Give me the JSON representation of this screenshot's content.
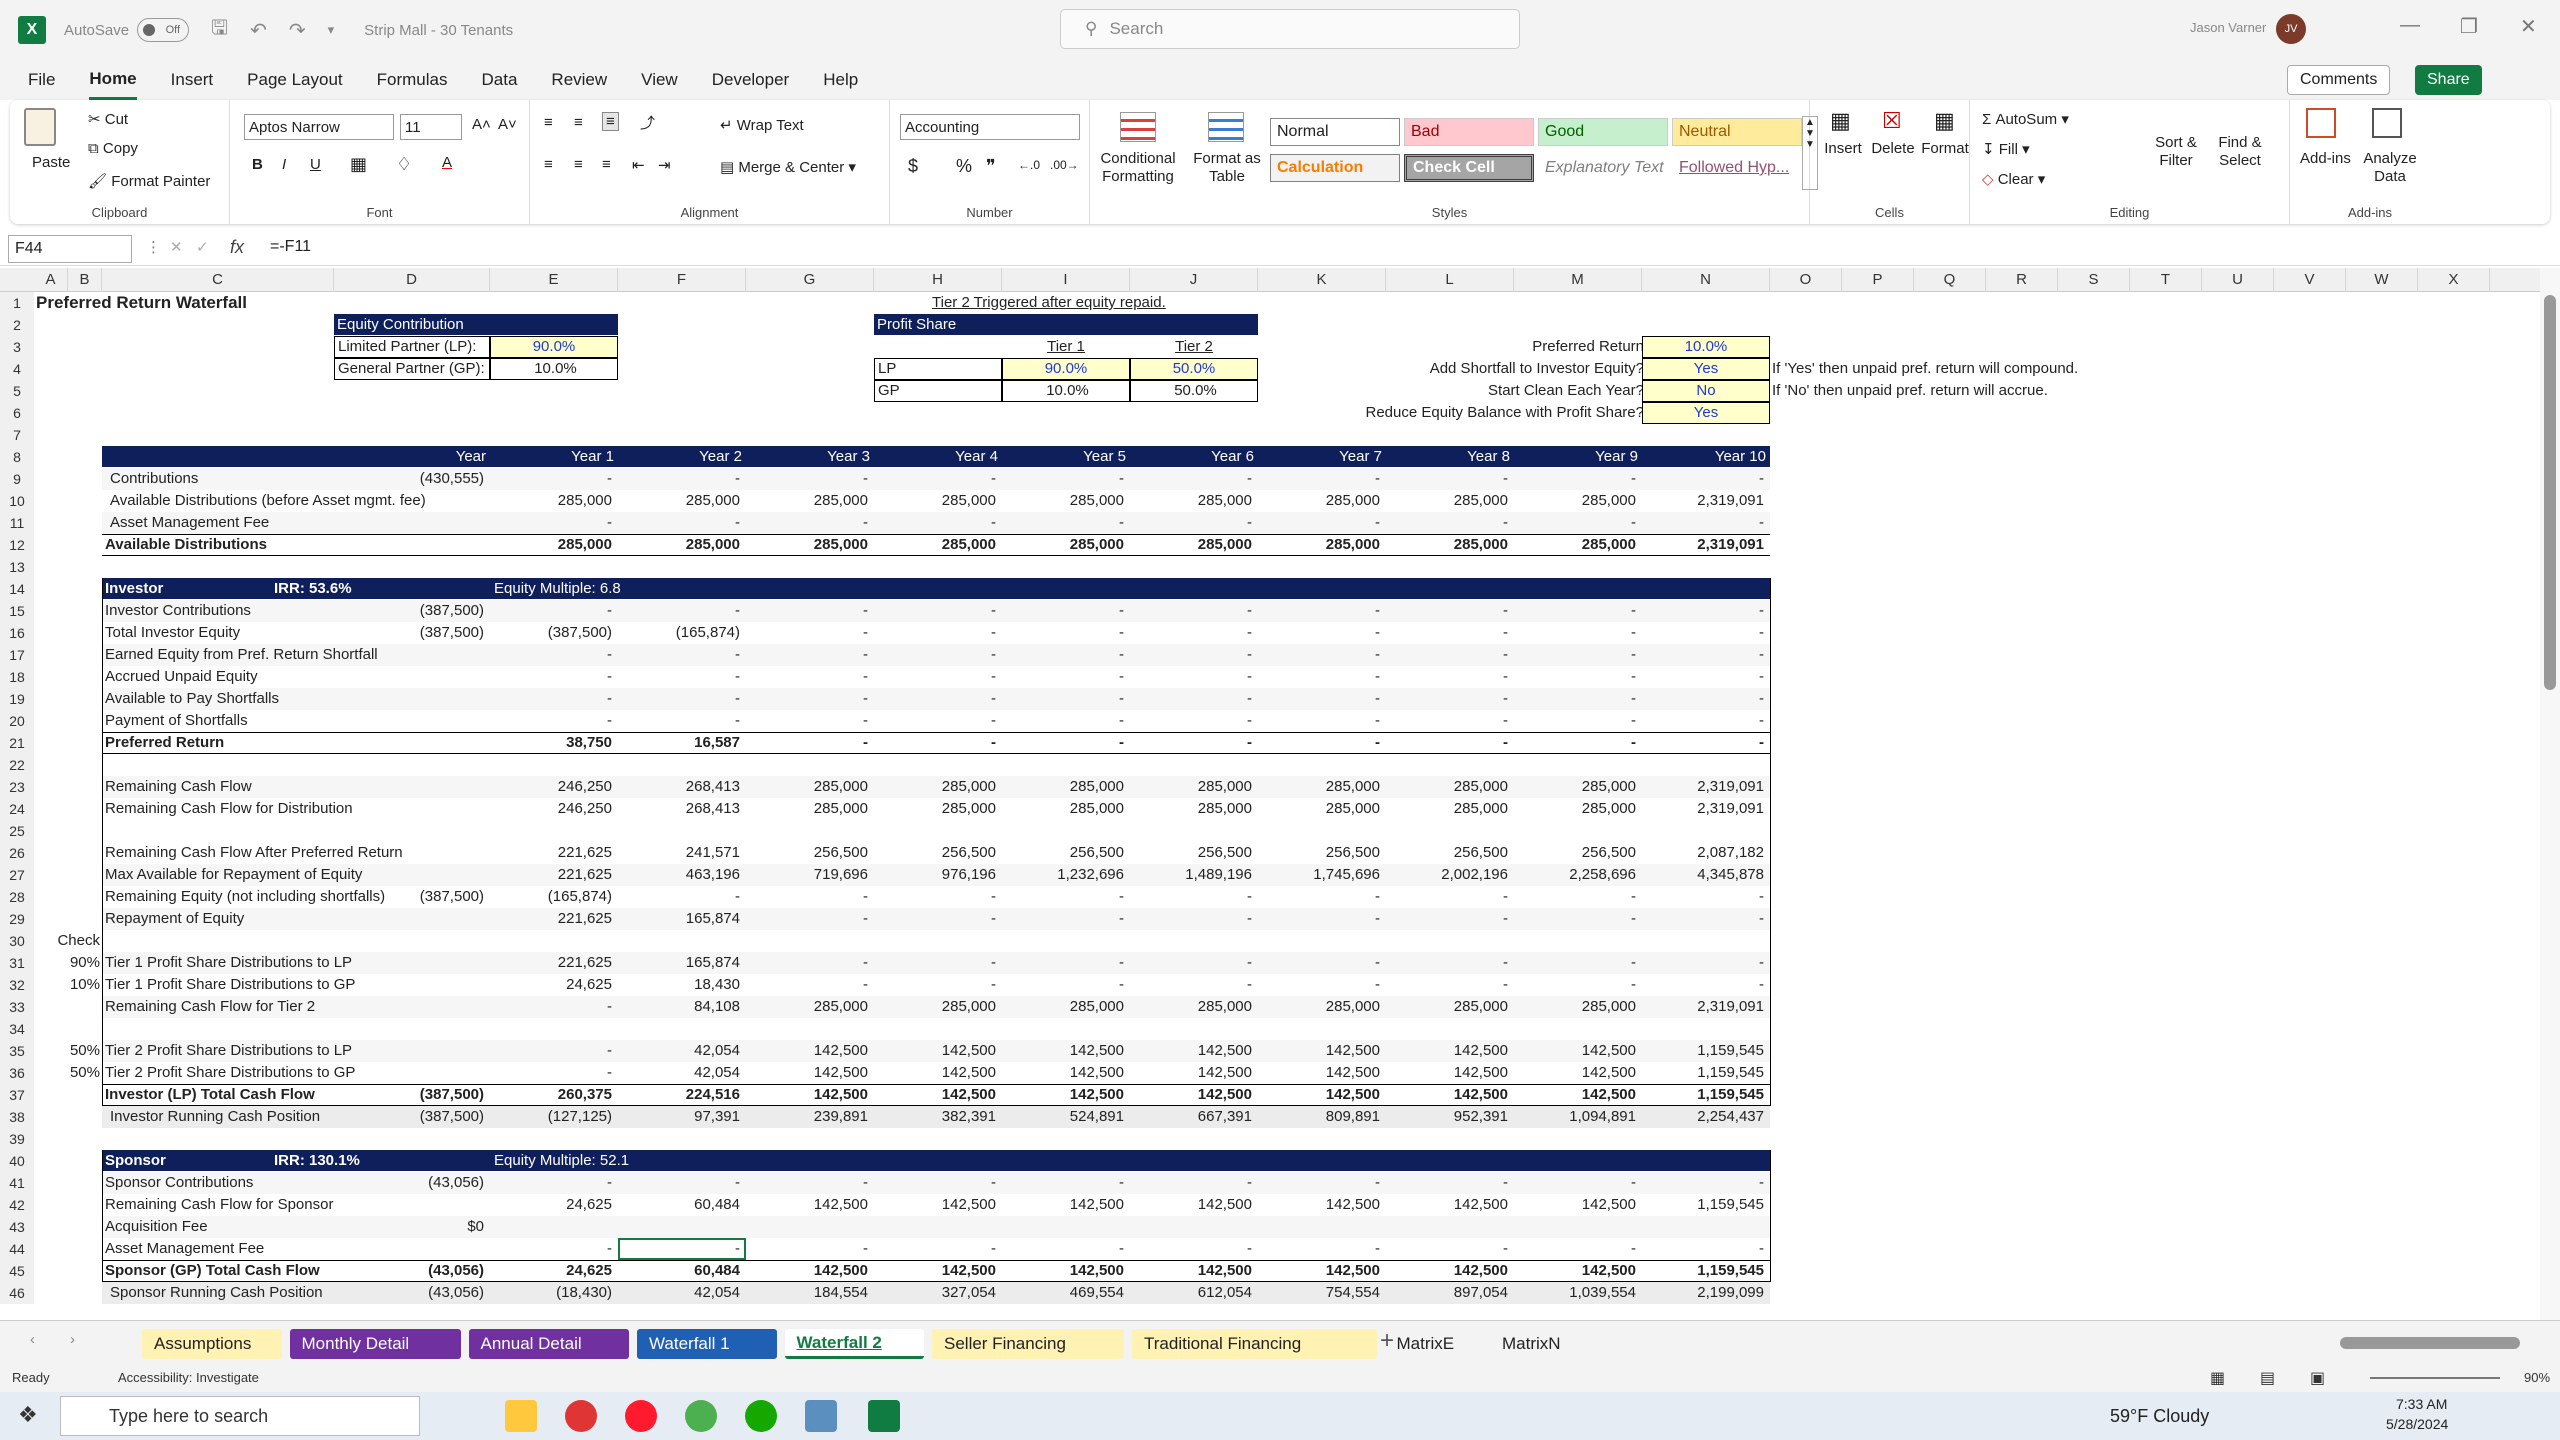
{
  "titlebar": {
    "autosave": "AutoSave",
    "autosave_state": "Off",
    "doc_title": "Strip Mall - 30 Tenants",
    "search_placeholder": "Search",
    "user": "Jason Varner",
    "initials": "JV"
  },
  "menu": [
    "File",
    "Home",
    "Insert",
    "Page Layout",
    "Formulas",
    "Data",
    "Review",
    "View",
    "Developer",
    "Help"
  ],
  "menu_active": "Home",
  "comments": "Comments",
  "share": "Share",
  "ribbon": {
    "clipboard": {
      "label": "Clipboard",
      "paste": "Paste",
      "cut": "Cut",
      "copy": "Copy",
      "format_painter": "Format Painter"
    },
    "font": {
      "label": "Font",
      "name": "Aptos Narrow",
      "size": "11"
    },
    "alignment": {
      "label": "Alignment",
      "wrap": "Wrap Text",
      "merge": "Merge & Center"
    },
    "number": {
      "label": "Number",
      "format": "Accounting"
    },
    "styles": {
      "label": "Styles",
      "cond": "Conditional Formatting",
      "fmt_table": "Format as Table",
      "normal": "Normal",
      "bad": "Bad",
      "good": "Good",
      "neutral": "Neutral",
      "calc": "Calculation",
      "check": "Check Cell",
      "explan": "Explanatory Text",
      "followed": "Followed Hyp..."
    },
    "cells": {
      "label": "Cells",
      "insert": "Insert",
      "delete": "Delete",
      "format": "Format"
    },
    "editing": {
      "label": "Editing",
      "autosum": "AutoSum",
      "fill": "Fill",
      "clear": "Clear",
      "sort": "Sort & Filter",
      "find": "Find & Select"
    },
    "addins": {
      "label": "Add-ins",
      "addins": "Add-ins",
      "analyze": "Analyze Data"
    }
  },
  "formula": {
    "cell": "F44",
    "text": "=-F11"
  },
  "columns": [
    "A",
    "B",
    "C",
    "D",
    "E",
    "F",
    "G",
    "H",
    "I",
    "J",
    "K",
    "L",
    "M",
    "N",
    "O",
    "P",
    "Q",
    "R",
    "S",
    "T",
    "U",
    "V",
    "W",
    "X"
  ],
  "sheet": {
    "title": "Preferred Return Waterfall",
    "equity": {
      "hdr": "Equity Contribution",
      "lp": "Limited Partner (LP):",
      "lp_v": "90.0%",
      "gp": "General Partner (GP):",
      "gp_v": "10.0%"
    },
    "tier_note": "Tier 2 Triggered after equity repaid.",
    "profit": {
      "hdr": "Profit Share",
      "t1": "Tier 1",
      "t2": "Tier 2",
      "lp": "LP",
      "gp": "GP",
      "lp1": "90.0%",
      "lp2": "50.0%",
      "gp1": "10.0%",
      "gp2": "50.0%"
    },
    "settings": [
      {
        "label": "Preferred Return",
        "value": "10.0%"
      },
      {
        "label": "Add Shortfall to Investor Equity?",
        "value": "Yes",
        "note": "If 'Yes' then unpaid pref. return will compound."
      },
      {
        "label": "Start Clean Each Year?",
        "value": "No",
        "note": "If 'No' then unpaid pref. return will accrue."
      },
      {
        "label": "Reduce Equity Balance with Profit Share?",
        "value": "Yes"
      }
    ],
    "year_hdr": [
      "Year",
      "Year 1",
      "Year 2",
      "Year 3",
      "Year 4",
      "Year 5",
      "Year 6",
      "Year 7",
      "Year 8",
      "Year 9",
      "Year 10"
    ],
    "investor": {
      "label": "Investor",
      "irr": "IRR: 53.6%",
      "em": "Equity Multiple: 6.8"
    },
    "sponsor": {
      "label": "Sponsor",
      "irr": "IRR: 130.1%",
      "em": "Equity Multiple: 52.1"
    },
    "check": "Check",
    "rows": [
      {
        "r": 9,
        "l": "Contributions",
        "ind": 1,
        "v": [
          "(430,555)",
          "-",
          "-",
          "-",
          "-",
          "-",
          "-",
          "-",
          "-",
          "-",
          "-"
        ]
      },
      {
        "r": 10,
        "l": "Available Distributions (before Asset mgmt. fee)",
        "ind": 1,
        "v": [
          "",
          "285,000",
          "285,000",
          "285,000",
          "285,000",
          "285,000",
          "285,000",
          "285,000",
          "285,000",
          "285,000",
          "2,319,091"
        ]
      },
      {
        "r": 11,
        "l": "Asset Management Fee",
        "ind": 1,
        "v": [
          "",
          "-",
          "-",
          "-",
          "-",
          "-",
          "-",
          "-",
          "-",
          "-",
          "-"
        ]
      },
      {
        "r": 12,
        "l": "Available Distributions",
        "b": 1,
        "v": [
          "",
          "285,000",
          "285,000",
          "285,000",
          "285,000",
          "285,000",
          "285,000",
          "285,000",
          "285,000",
          "285,000",
          "2,319,091"
        ]
      },
      {
        "r": 15,
        "l": "Investor Contributions",
        "v": [
          "(387,500)",
          "-",
          "-",
          "-",
          "-",
          "-",
          "-",
          "-",
          "-",
          "-",
          "-"
        ]
      },
      {
        "r": 16,
        "l": "Total Investor Equity",
        "v": [
          "(387,500)",
          "(387,500)",
          "(165,874)",
          "-",
          "-",
          "-",
          "-",
          "-",
          "-",
          "-",
          "-"
        ]
      },
      {
        "r": 17,
        "l": "Earned Equity from Pref. Return Shortfall",
        "v": [
          "",
          "-",
          "-",
          "-",
          "-",
          "-",
          "-",
          "-",
          "-",
          "-",
          "-"
        ]
      },
      {
        "r": 18,
        "l": "Accrued Unpaid Equity",
        "v": [
          "",
          "-",
          "-",
          "-",
          "-",
          "-",
          "-",
          "-",
          "-",
          "-",
          "-"
        ]
      },
      {
        "r": 19,
        "l": "Available to Pay Shortfalls",
        "v": [
          "",
          "-",
          "-",
          "-",
          "-",
          "-",
          "-",
          "-",
          "-",
          "-",
          "-"
        ]
      },
      {
        "r": 20,
        "l": "Payment of Shortfalls",
        "v": [
          "",
          "-",
          "-",
          "-",
          "-",
          "-",
          "-",
          "-",
          "-",
          "-",
          "-"
        ]
      },
      {
        "r": 21,
        "l": "Preferred Return",
        "b": 1,
        "v": [
          "",
          "38,750",
          "16,587",
          "-",
          "-",
          "-",
          "-",
          "-",
          "-",
          "-",
          "-"
        ]
      },
      {
        "r": 23,
        "l": "Remaining Cash Flow",
        "v": [
          "",
          "246,250",
          "268,413",
          "285,000",
          "285,000",
          "285,000",
          "285,000",
          "285,000",
          "285,000",
          "285,000",
          "2,319,091"
        ]
      },
      {
        "r": 24,
        "l": "Remaining Cash Flow for Distribution",
        "v": [
          "",
          "246,250",
          "268,413",
          "285,000",
          "285,000",
          "285,000",
          "285,000",
          "285,000",
          "285,000",
          "285,000",
          "2,319,091"
        ]
      },
      {
        "r": 26,
        "l": "Remaining Cash Flow After Preferred Return",
        "v": [
          "",
          "221,625",
          "241,571",
          "256,500",
          "256,500",
          "256,500",
          "256,500",
          "256,500",
          "256,500",
          "256,500",
          "2,087,182"
        ]
      },
      {
        "r": 27,
        "l": "Max Available for Repayment of Equity",
        "v": [
          "",
          "221,625",
          "463,196",
          "719,696",
          "976,196",
          "1,232,696",
          "1,489,196",
          "1,745,696",
          "2,002,196",
          "2,258,696",
          "4,345,878"
        ]
      },
      {
        "r": 28,
        "l": "Remaining Equity (not including shortfalls)",
        "v": [
          "(387,500)",
          "(165,874)",
          "-",
          "-",
          "-",
          "-",
          "-",
          "-",
          "-",
          "-",
          "-"
        ]
      },
      {
        "r": 29,
        "l": "Repayment of Equity",
        "v": [
          "",
          "221,625",
          "165,874",
          "-",
          "-",
          "-",
          "-",
          "-",
          "-",
          "-",
          "-"
        ]
      },
      {
        "r": 31,
        "l": "Tier 1 Profit Share Distributions to LP",
        "pct": "90%",
        "v": [
          "",
          "221,625",
          "165,874",
          "-",
          "-",
          "-",
          "-",
          "-",
          "-",
          "-",
          "-"
        ]
      },
      {
        "r": 32,
        "l": "Tier 1 Profit Share Distributions to GP",
        "pct": "10%",
        "v": [
          "",
          "24,625",
          "18,430",
          "-",
          "-",
          "-",
          "-",
          "-",
          "-",
          "-",
          "-"
        ]
      },
      {
        "r": 33,
        "l": "Remaining Cash Flow for Tier 2",
        "v": [
          "",
          "-",
          "84,108",
          "285,000",
          "285,000",
          "285,000",
          "285,000",
          "285,000",
          "285,000",
          "285,000",
          "2,319,091"
        ]
      },
      {
        "r": 35,
        "l": "Tier 2 Profit Share Distributions to LP",
        "pct": "50%",
        "v": [
          "",
          "-",
          "42,054",
          "142,500",
          "142,500",
          "142,500",
          "142,500",
          "142,500",
          "142,500",
          "142,500",
          "1,159,545"
        ]
      },
      {
        "r": 36,
        "l": "Tier 2 Profit Share Distributions to GP",
        "pct": "50%",
        "v": [
          "",
          "-",
          "42,054",
          "142,500",
          "142,500",
          "142,500",
          "142,500",
          "142,500",
          "142,500",
          "142,500",
          "1,159,545"
        ]
      },
      {
        "r": 37,
        "l": "Investor (LP) Total Cash Flow",
        "b": 1,
        "v": [
          "(387,500)",
          "260,375",
          "224,516",
          "142,500",
          "142,500",
          "142,500",
          "142,500",
          "142,500",
          "142,500",
          "142,500",
          "1,159,545"
        ]
      },
      {
        "r": 38,
        "l": "Investor Running Cash Position",
        "ind": 1,
        "v": [
          "(387,500)",
          "(127,125)",
          "97,391",
          "239,891",
          "382,391",
          "524,891",
          "667,391",
          "809,891",
          "952,391",
          "1,094,891",
          "2,254,437"
        ]
      },
      {
        "r": 41,
        "l": "Sponsor Contributions",
        "v": [
          "(43,056)",
          "-",
          "-",
          "-",
          "-",
          "-",
          "-",
          "-",
          "-",
          "-",
          "-"
        ]
      },
      {
        "r": 42,
        "l": "Remaining Cash Flow for Sponsor",
        "v": [
          "",
          "24,625",
          "60,484",
          "142,500",
          "142,500",
          "142,500",
          "142,500",
          "142,500",
          "142,500",
          "142,500",
          "1,159,545"
        ]
      },
      {
        "r": 43,
        "l": "Acquisition Fee",
        "v": [
          "$0",
          "",
          "",
          "",
          "",
          "",
          "",
          "",
          "",
          "",
          ""
        ]
      },
      {
        "r": 44,
        "l": "Asset Management Fee",
        "v": [
          "",
          "-",
          "-",
          "-",
          "-",
          "-",
          "-",
          "-",
          "-",
          "-",
          "-"
        ]
      },
      {
        "r": 45,
        "l": "Sponsor (GP) Total Cash Flow",
        "b": 1,
        "v": [
          "(43,056)",
          "24,625",
          "60,484",
          "142,500",
          "142,500",
          "142,500",
          "142,500",
          "142,500",
          "142,500",
          "142,500",
          "1,159,545"
        ]
      },
      {
        "r": 46,
        "l": "Sponsor Running Cash Position",
        "ind": 1,
        "v": [
          "(43,056)",
          "(18,430)",
          "42,054",
          "184,554",
          "327,054",
          "469,554",
          "612,054",
          "754,554",
          "897,054",
          "1,039,554",
          "2,199,099"
        ]
      }
    ]
  },
  "tabs": [
    {
      "name": "Assumptions",
      "bg": "#fff2b3",
      "fg": "#222"
    },
    {
      "name": "Monthly Detail",
      "bg": "#7030a0",
      "fg": "#fff"
    },
    {
      "name": "Annual Detail",
      "bg": "#7030a0",
      "fg": "#fff"
    },
    {
      "name": "Waterfall 1",
      "bg": "#1f5fb4",
      "fg": "#fff"
    },
    {
      "name": "Waterfall 2",
      "bg": "#ffffff",
      "fg": "#107c41",
      "active": true
    },
    {
      "name": "Seller Financing",
      "bg": "#fff2b3",
      "fg": "#222"
    },
    {
      "name": "Traditional Financing",
      "bg": "#fff2b3",
      "fg": "#222"
    },
    {
      "name": "MatrixE",
      "bg": "",
      "fg": "#222"
    },
    {
      "name": "MatrixN",
      "bg": "",
      "fg": "#222"
    }
  ],
  "status": {
    "ready": "Ready",
    "access": "Accessibility: Investigate",
    "zoom": "90%"
  },
  "taskbar": {
    "search": "Type here to search",
    "weather": "59°F  Cloudy",
    "time": "7:33 AM",
    "date": "5/28/2024"
  }
}
